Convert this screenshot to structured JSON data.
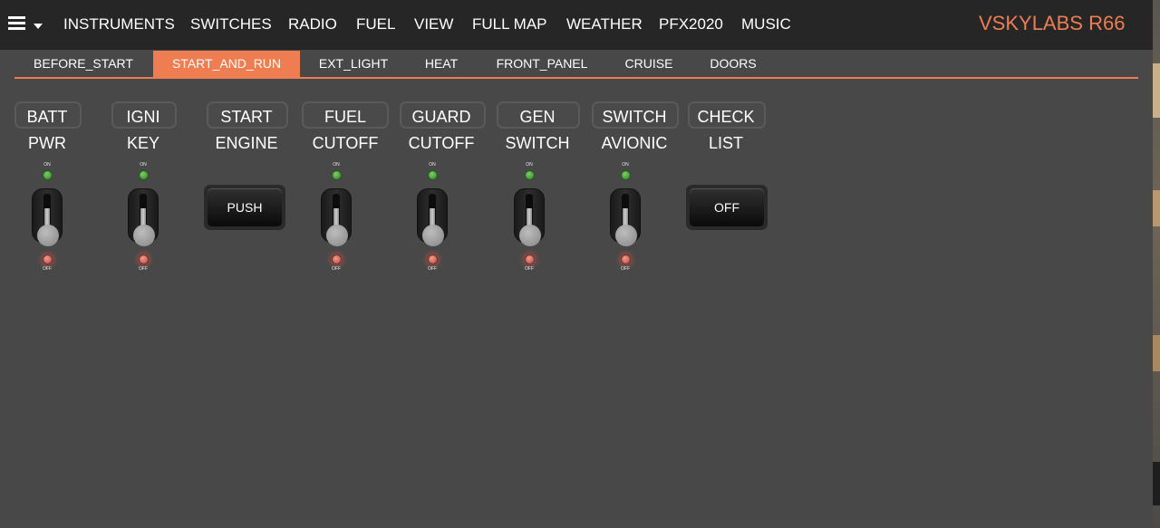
{
  "nav": {
    "items": [
      "INSTRUMENTS",
      "SWITCHES",
      "RADIO",
      "FUEL",
      "VIEW",
      "FULL MAP",
      "WEATHER",
      "PFX2020",
      "MUSIC"
    ],
    "brand": "VSKYLABS R66"
  },
  "tabs": {
    "items": [
      "BEFORE_START",
      "START_AND_RUN",
      "EXT_LIGHT",
      "HEAT",
      "FRONT_PANEL",
      "CRUISE",
      "DOORS"
    ],
    "active": "START_AND_RUN"
  },
  "controls": [
    {
      "line1": "BATT",
      "line2": "PWR",
      "type": "toggle",
      "on_label": "ON",
      "off_label": "OFF"
    },
    {
      "line1": "IGNI",
      "line2": "KEY",
      "type": "toggle",
      "on_label": "ON",
      "off_label": "OFF"
    },
    {
      "line1": "START",
      "line2": "ENGINE",
      "type": "button",
      "button_label": "PUSH"
    },
    {
      "line1": "FUEL",
      "line2": "CUTOFF",
      "type": "toggle",
      "on_label": "ON",
      "off_label": "OFF"
    },
    {
      "line1": "GUARD",
      "line2": "CUTOFF",
      "type": "toggle",
      "on_label": "ON",
      "off_label": "OFF"
    },
    {
      "line1": "GEN",
      "line2": "SWITCH",
      "type": "toggle",
      "on_label": "ON",
      "off_label": "OFF"
    },
    {
      "line1": "SWITCH",
      "line2": "AVIONIC",
      "type": "toggle",
      "on_label": "ON",
      "off_label": "OFF"
    },
    {
      "line1": "CHECK",
      "line2": "LIST",
      "type": "button",
      "button_label": "OFF"
    }
  ],
  "colors": {
    "accent": "#ee7d52",
    "topbar": "#262626",
    "background": "#484848",
    "led_on": "#4caf3a",
    "led_off": "#e0685c"
  },
  "icons": {
    "menu": "hamburger-icon",
    "menu_caret": "chevron-down-icon"
  }
}
